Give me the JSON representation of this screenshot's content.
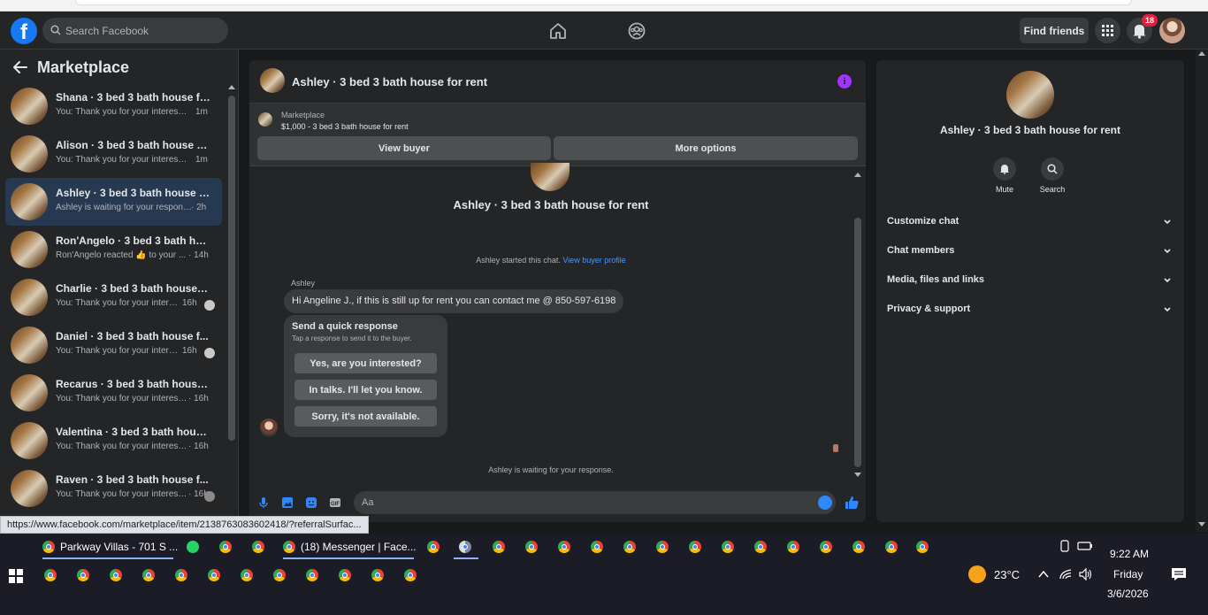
{
  "header": {
    "logo": "f",
    "search_placeholder": "Search Facebook",
    "find_friends": "Find friends",
    "notification_count": "18",
    "icons": [
      "facebook-logo-icon",
      "search-icon",
      "home-icon",
      "groups-icon",
      "grid-menu-icon",
      "bell-icon",
      "avatar"
    ]
  },
  "sidebar": {
    "title": "Marketplace",
    "conversations": [
      {
        "name": "Shana · 3 bed 3 bath house for ...",
        "preview": "You: Thank you for your interest. T...",
        "time": "1m"
      },
      {
        "name": "Alison · 3 bed 3 bath house for ...",
        "preview": "You: Thank you for your interest. T...",
        "time": "1m"
      },
      {
        "name": "Ashley · 3 bed 3 bath house for ...",
        "preview": "Ashley is waiting for your response.",
        "time": "· 2h"
      },
      {
        "name": "Ron'Angelo · 3 bed 3 bath hous...",
        "preview": "Ron'Angelo reacted 👍 to your ...",
        "time": "· 14h"
      },
      {
        "name": "Charlie · 3 bed 3 bath house f...",
        "preview": "You: Thank you for your intere...",
        "time": "16h"
      },
      {
        "name": "Daniel · 3 bed 3 bath house f...",
        "preview": "You: Thank you for your intere...",
        "time": "16h"
      },
      {
        "name": "Recarus · 3 bed 3 bath house fo...",
        "preview": "You: Thank you for your interest. ...",
        "time": "· 16h"
      },
      {
        "name": "Valentina · 3 bed 3 bath house f...",
        "preview": "You: Thank you for your interest. ...",
        "time": "· 16h"
      },
      {
        "name": "Raven · 3 bed 3 bath house f...",
        "preview": "You: Thank you for your interest. ...",
        "time": "· 16h"
      }
    ]
  },
  "chat": {
    "title": "Ashley · 3 bed 3 bath house for rent",
    "marketplace_label": "Marketplace",
    "listing": "$1,000 - 3 bed 3 bath house for rent",
    "view_buyer": "View buyer",
    "more_options": "More options",
    "center_title": "Ashley · 3 bed 3 bath house for rent",
    "started_text": "Ashley started this chat.",
    "buyer_profile_link": "View buyer profile",
    "sender": "Ashley",
    "message": "Hi Angeline J., if this is still up for rent you can contact me @ 850-597-6198",
    "quick_title": "Send a quick response",
    "quick_subtitle": "Tap a response to send it to the buyer.",
    "quick_replies": [
      "Yes, are you interested?",
      "In talks. I'll let you know.",
      "Sorry, it's not available."
    ],
    "waiting": "Ashley is waiting for your response.",
    "composer_placeholder": "Aa"
  },
  "info_panel": {
    "name": "Ashley · 3 bed 3 bath house for rent",
    "actions": [
      "Mute",
      "Search"
    ],
    "sections": [
      "Customize chat",
      "Chat members",
      "Media, files and links",
      "Privacy & support"
    ]
  },
  "status_url": "https://www.facebook.com/marketplace/item/2138763083602418/?referralSurfac...",
  "taskbar": {
    "task1": "Parkway Villas - 701 S ...",
    "task2": "(18) Messenger | Face...",
    "weather": "23°C",
    "time": "9:22 AM",
    "day": "Friday",
    "date": "3/6/2026"
  },
  "colors": {
    "accent": "#2d88ff",
    "info": "#a033ff",
    "badge": "#e41e3f",
    "background": "#18191a",
    "surface": "#242526"
  }
}
